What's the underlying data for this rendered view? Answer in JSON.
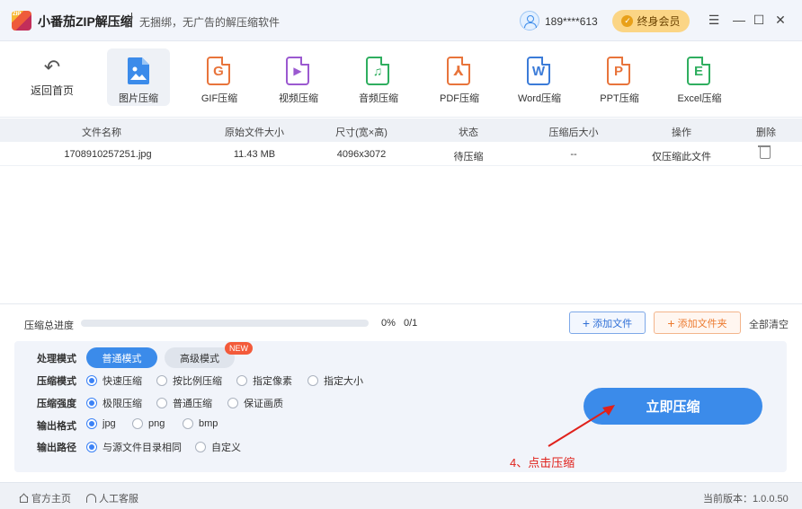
{
  "titlebar": {
    "logo_text": "ZIP",
    "app_name": "小番茄ZIP解压缩",
    "slogan": "无捆绑，无广告的解压缩软件",
    "user_phone": "189****613",
    "vip_label": "终身会员"
  },
  "toolbar": {
    "back_label": "返回首页",
    "tools": [
      {
        "label": "图片压缩",
        "color": "#3b8bea"
      },
      {
        "label": "GIF压缩",
        "glyph": "G",
        "color": "#e8743b"
      },
      {
        "label": "视频压缩",
        "glyph": "▶",
        "color": "#9b59d0"
      },
      {
        "label": "音频压缩",
        "glyph": "♫",
        "color": "#2fae5f"
      },
      {
        "label": "PDF压缩",
        "glyph": "⅄",
        "color": "#e8743b"
      },
      {
        "label": "Word压缩",
        "glyph": "W",
        "color": "#3b7bd8"
      },
      {
        "label": "PPT压缩",
        "glyph": "P",
        "color": "#e8743b"
      },
      {
        "label": "Excel压缩",
        "glyph": "E",
        "color": "#2fae5f"
      }
    ]
  },
  "table": {
    "headers": [
      "文件名称",
      "原始文件大小",
      "尺寸(宽×高)",
      "状态",
      "压缩后大小",
      "操作",
      "删除"
    ],
    "rows": [
      {
        "name": "1708910257251.jpg",
        "size": "11.43 MB",
        "dims": "4096x3072",
        "status": "待压缩",
        "after": "--",
        "action": "仅压缩此文件"
      }
    ]
  },
  "progress": {
    "label": "压缩总进度",
    "fraction": 0,
    "percent_text": "0%",
    "count_text": "0/1",
    "add_file": "添加文件",
    "add_folder": "添加文件夹",
    "clear_all": "全部清空"
  },
  "settings": {
    "process_mode_label": "处理模式",
    "mode_normal": "普通模式",
    "mode_advanced": "高级模式",
    "new_badge": "NEW",
    "compress_mode_label": "压缩模式",
    "compress_modes": [
      "快速压缩",
      "按比例压缩",
      "指定像素",
      "指定大小"
    ],
    "strength_label": "压缩强度",
    "strengths": [
      "极限压缩",
      "普通压缩",
      "保证画质"
    ],
    "format_label": "输出格式",
    "formats": [
      "jpg",
      "png",
      "bmp"
    ],
    "path_label": "输出路径",
    "paths": [
      "与源文件目录相同",
      "自定义"
    ],
    "compress_button": "立即压缩"
  },
  "annotation": {
    "text": "4、点击压缩",
    "color": "#e0211b"
  },
  "footer": {
    "home": "官方主页",
    "support": "人工客服",
    "version": "当前版本：1.0.0.50"
  }
}
